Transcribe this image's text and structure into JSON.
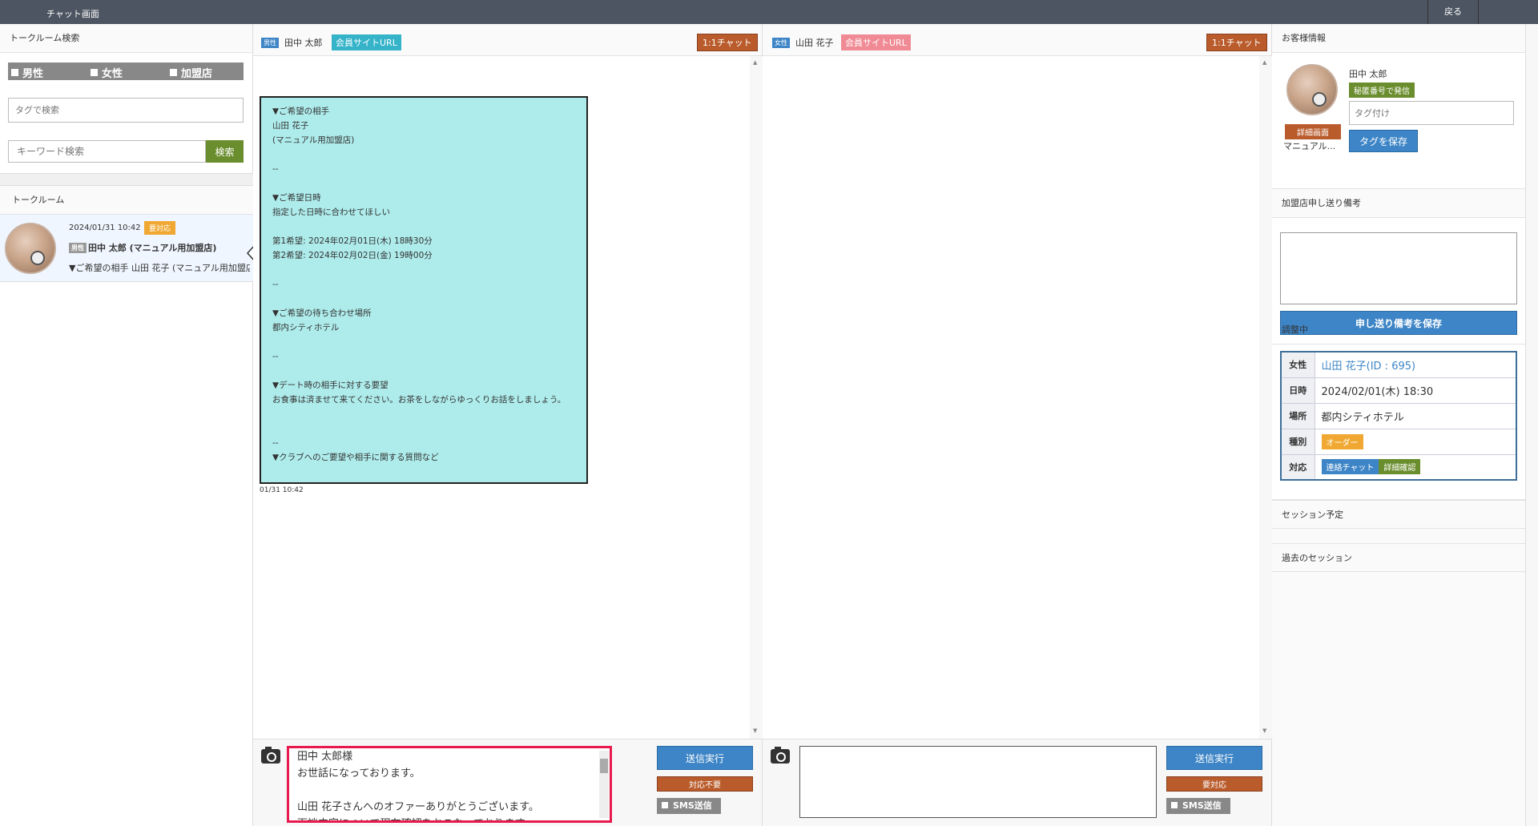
{
  "topbar": {
    "title": "チャット画面",
    "back": "戻る"
  },
  "left": {
    "search_head": "トークルーム検索",
    "filters": [
      "男性",
      "女性",
      "加盟店"
    ],
    "tag_placeholder": "タグで検索",
    "keyword_placeholder": "キーワード検索",
    "search_button": "検索",
    "room_head": "トークルーム",
    "room": {
      "datetime": "2024/01/31 10:42",
      "badge": "要対応",
      "gender": "男性",
      "name": "田中 太郎 (マニュアル用加盟店)",
      "preview": "▼ご希望の相手 山田 花子 (マニュアル用加盟店)"
    }
  },
  "panel_male": {
    "gender": "男性",
    "name": "田中 太郎",
    "url_button": "会員サイトURL",
    "chat_button": "1:1チャット",
    "message": "▼ご希望の相手\n山田 花子\n(マニュアル用加盟店)\n\n--\n\n▼ご希望日時\n指定した日時に合わせてほしい\n\n第1希望: 2024年02月01日(木) 18時30分\n第2希望: 2024年02月02日(金) 19時00分\n\n--\n\n▼ご希望の待ち合わせ場所\n都内シティホテル\n\n--\n\n▼デート時の相手に対する要望\nお食事は済ませて来てください。お茶をしながらゆっくりお話をしましょう。\n\n\n--\n▼クラブへのご要望や相手に関する質問など",
    "message_time": "01/31 10:42",
    "compose_text": "田中 太郎様\nお世話になっております。\n\n山田 花子さんへのオファーありがとうございます。\n面談内容について現在確認をおこなっております。",
    "send_button": "送信実行",
    "status_button": "対応不要",
    "sms_label": "SMS送信"
  },
  "panel_female": {
    "gender": "女性",
    "name": "山田 花子",
    "url_button": "会員サイトURL",
    "chat_button": "1:1チャット",
    "send_button": "送信実行",
    "status_button": "要対応",
    "sms_label": "SMS送信"
  },
  "right": {
    "customer_head": "お客様情報",
    "customer_name": "田中 太郎",
    "secret_button": "秘匿番号で発信",
    "detail_button": "詳細画面",
    "store_short": "マニュアル...",
    "tag_placeholder": "タグ付け",
    "save_tag": "タグを保存",
    "notes_head": "加盟店申し送り備考",
    "save_notes": "申し送り備考を保存",
    "adjust_head": "調整中",
    "adjust": {
      "k_female": "女性",
      "female": "山田 花子(ID : 695)",
      "k_date": "日時",
      "date": "2024/02/01(木) 18:30",
      "k_place": "場所",
      "place": "都内シティホテル",
      "k_type": "種別",
      "type": "オーダー",
      "k_action": "対応",
      "contact_chat": "連絡チャット",
      "detail_check": "詳細確認"
    },
    "session_planned": "セッション予定",
    "session_past": "過去のセッション"
  },
  "colors": {
    "accent_blue": "#3d85c6",
    "brown": "#b95b2b",
    "green": "#6a8d2d",
    "orange": "#f0a832",
    "bubble": "#aeeceb",
    "highlight": "#e8194f"
  }
}
